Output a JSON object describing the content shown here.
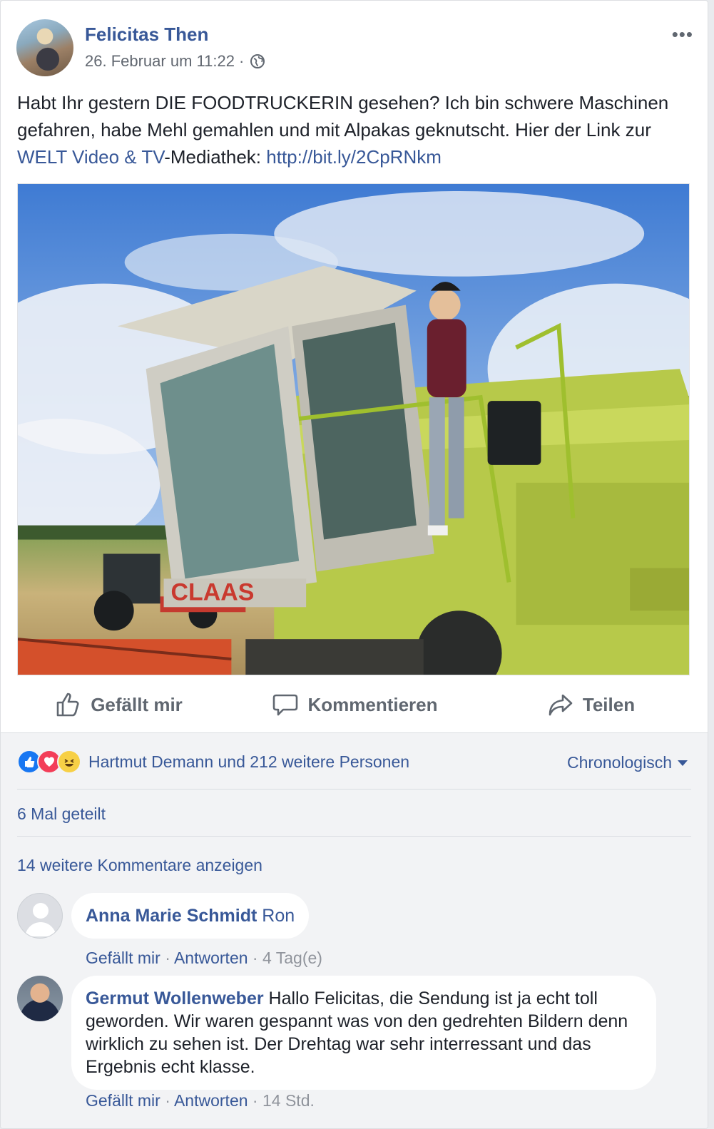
{
  "post": {
    "author": "Felicitas Then",
    "timestamp": "26. Februar um 11:22 ·",
    "more_label": "•••",
    "text_plain_1": "Habt Ihr gestern DIE FOODTRUCKERIN gesehen? Ich bin schwere Maschinen gefahren, habe Mehl gemahlen und mit Alpakas geknutscht. Hier der Link zur ",
    "text_link_1": "WELT Video & TV",
    "text_plain_2": "-Mediathek: ",
    "text_link_2": "http://bit.ly/2CpRNkm",
    "photo_lettering": "CLAAS"
  },
  "actions": {
    "like": "Gefällt mir",
    "comment": "Kommentieren",
    "share": "Teilen"
  },
  "reactions": {
    "summary": "Hartmut Demann und 212 weitere Personen",
    "sort_label": "Chronologisch"
  },
  "shares": "6 Mal geteilt",
  "more_comments": "14 weitere Kommentare anzeigen",
  "comments": [
    {
      "author": "Anna Marie Schmidt",
      "text": " Ron",
      "like": "Gefällt mir",
      "reply": "Antworten",
      "time": "4 Tag(e)"
    },
    {
      "author": "Germut Wollenweber",
      "text": " Hallo Felicitas, die Sendung ist ja echt toll geworden. Wir waren gespannt was von den gedrehten Bildern denn wirklich zu sehen ist. Der Drehtag war sehr interressant und das Ergebnis echt klasse.",
      "like": "Gefällt mir",
      "reply": "Antworten",
      "time": "14 Std."
    }
  ],
  "icons": {
    "globe": "globe-icon",
    "like": "thumbs-up-icon",
    "comment": "speech-bubble-icon",
    "share": "share-arrow-icon"
  },
  "colors": {
    "link": "#385898",
    "muted": "#606770",
    "background": "#f2f3f5"
  }
}
